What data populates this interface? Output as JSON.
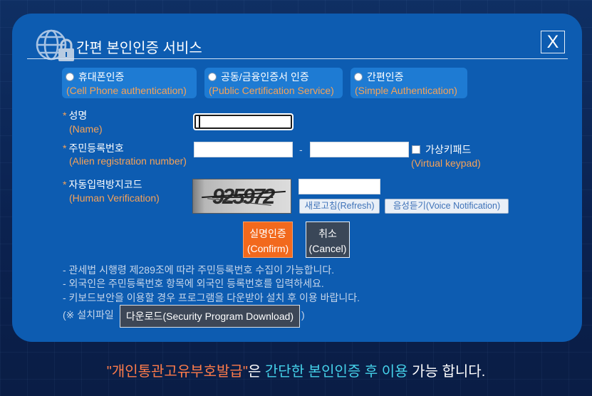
{
  "header": {
    "logo_icon": "globe-lock-icon",
    "title": "간편 본인인증 서비스",
    "close_label": "X"
  },
  "auth_methods": [
    {
      "label": "휴대폰인증",
      "sublabel": "(Cell Phone authentication)",
      "selected": false
    },
    {
      "label": "공동/금융인증서 인증",
      "sublabel": "(Public Certification Service)",
      "selected": false
    },
    {
      "label": "간편인증",
      "sublabel": "(Simple Authentication)",
      "selected": false
    }
  ],
  "form": {
    "required_mark": "*",
    "name": {
      "label": "성명",
      "sublabel": "(Name)"
    },
    "registration": {
      "label": "주민등록번호",
      "sublabel": "(Alien registration number)",
      "separator": "-",
      "virtual_keypad": {
        "label": "가상키패드",
        "sublabel": "(Virtual keypad)",
        "checked": false
      }
    },
    "captcha": {
      "label": "자동입력방지코드",
      "sublabel": "(Human Verification)",
      "code": "925972",
      "refresh_label": "새로고침(Refresh)",
      "voice_label": "음성듣기(Voice Notification)"
    }
  },
  "actions": {
    "confirm": {
      "label": "실명인증",
      "sublabel": "(Confirm)"
    },
    "cancel": {
      "label": "취소",
      "sublabel": "(Cancel)"
    }
  },
  "notes": [
    "- 관세법 시행령 제289조에 따라 주민등록번호 수집이 가능합니다.",
    "- 외국인은 주민등록번호 항목에 외국인 등록번호를 입력하세요.",
    "- 키보드보안을 이용할 경우 프로그램을 다운받아 설치 후 이용 바랍니다."
  ],
  "download": {
    "prefix": "(※ 설치파일",
    "button_label": "다운로드(Security Program Download)",
    "suffix": ")"
  },
  "footer": {
    "highlight": "\"개인통관고유부호발급\"",
    "text_after_highlight": "은 ",
    "emphasis": "간단한 본인인증 후 이용",
    "text_end": " 가능 합니다."
  },
  "colors": {
    "page_bg": "#0b2250",
    "panel_bg": "#0d5cb1",
    "option_bg": "#1e7bd3",
    "accent_orange": "#f6a258",
    "confirm_bg": "#f2691d",
    "cancel_bg": "#3a4758",
    "download_bg": "#3d4757",
    "footer_highlight": "#ff7c4a",
    "footer_emphasis": "#45d2ea"
  }
}
